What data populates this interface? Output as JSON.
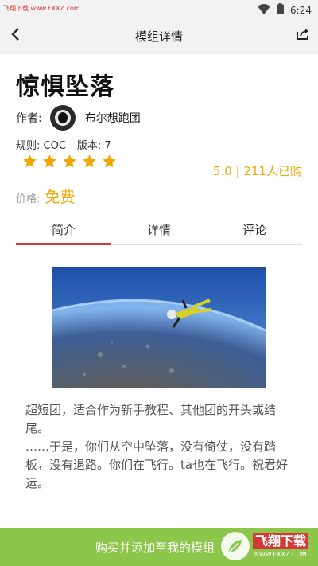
{
  "status_bar": {
    "watermark_text": "飞翔下载 www.FXXZ.com",
    "time": "6:24"
  },
  "header": {
    "title": "模组详情"
  },
  "module": {
    "title": "惊惧坠落",
    "author_label": "作者:",
    "author_name": "布尔想跑团",
    "rules": "规则: COC",
    "version": "版本: 7",
    "stars": 5,
    "rating_text": "5.0 | 211人已购",
    "price_label": "价格:",
    "price_value": "免费"
  },
  "tabs": [
    {
      "label": "简介",
      "active": true
    },
    {
      "label": "详情",
      "active": false
    },
    {
      "label": "评论",
      "active": false
    }
  ],
  "description": {
    "paragraph1": "超短团，适合作为新手教程、其他团的开头或结尾。",
    "paragraph2": "……于是，你们从空中坠落，没有倚仗，没有踏板，没有退路。你们在飞行。ta也在飞行。祝君好运。"
  },
  "bottom": {
    "action_label": "购买并添加至我的模组",
    "watermark_title": "飞翔下载",
    "watermark_url": "WWW.FXXZ.COM"
  },
  "colors": {
    "accent": "#f0a500",
    "tab_indicator": "#d23a3a",
    "action_bar": "#8cc64a",
    "header_bg": "#f2f2f2"
  }
}
